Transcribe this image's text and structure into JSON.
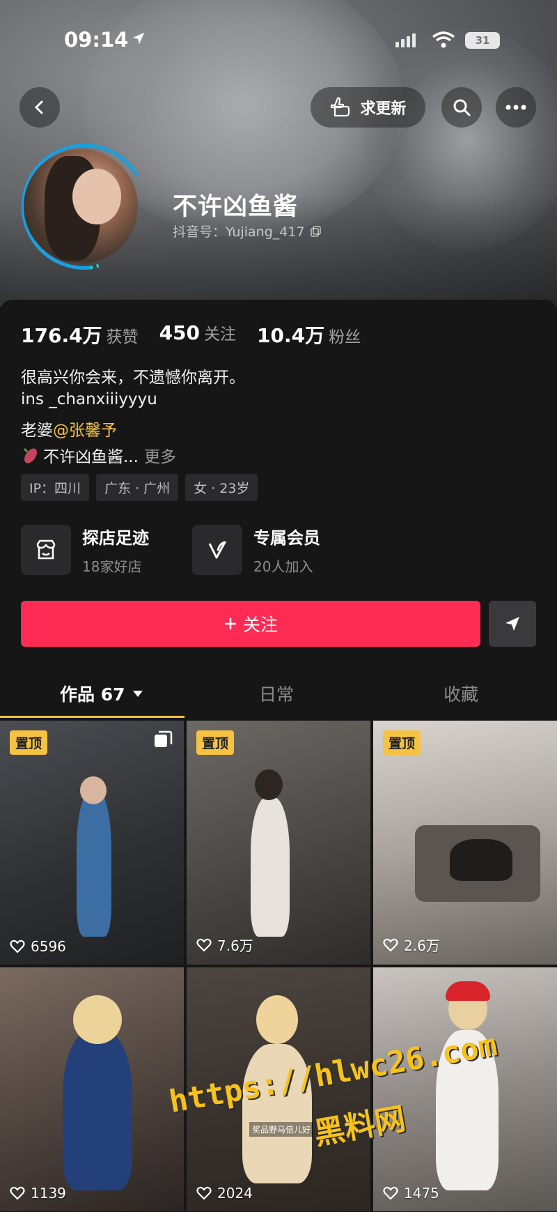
{
  "status": {
    "time": "09:14",
    "battery": "31"
  },
  "header": {
    "request_update_label": "求更新"
  },
  "profile": {
    "name": "不许凶鱼酱",
    "douyin_id": "抖音号：Yujiang_417",
    "stats": [
      {
        "value": "176.4万",
        "label": "获赞"
      },
      {
        "value": "450",
        "label": "关注"
      },
      {
        "value": "10.4万",
        "label": "粉丝"
      }
    ],
    "bio": {
      "line1": "很高兴你会来，不遗憾你离开。",
      "line2": "ins _chanxiiiyyyu",
      "line3_prefix": "老婆",
      "line3_mention": "@张馨予",
      "line4_text": "不许凶鱼酱...",
      "line4_more": "更多"
    },
    "tags": [
      "IP：四川",
      "广东 · 广州",
      "女 · 23岁"
    ],
    "entries": [
      {
        "title": "探店足迹",
        "sub": "18家好店",
        "icon": "store-icon"
      },
      {
        "title": "专属会员",
        "sub": "20人加入",
        "icon": "vip-icon"
      }
    ],
    "follow_label": "关注"
  },
  "tabs": [
    {
      "label": "作品 67"
    },
    {
      "label": "日常"
    },
    {
      "label": "收藏"
    }
  ],
  "videos": [
    {
      "pinned": "置顶",
      "likes": "6596",
      "multi": true
    },
    {
      "pinned": "置顶",
      "likes": "7.6万"
    },
    {
      "pinned": "置顶",
      "likes": "2.6万"
    },
    {
      "likes": "1139"
    },
    {
      "likes": "2024"
    },
    {
      "likes": "1475"
    }
  ],
  "watermark": {
    "line1": "https://hlwc26.com",
    "line2": "黑料网",
    "caption": "奖品野马倍儿好"
  },
  "colors": {
    "accent_follow": "#fe2c55",
    "mention": "#f5c242",
    "pin_badge": "#f5c242"
  }
}
